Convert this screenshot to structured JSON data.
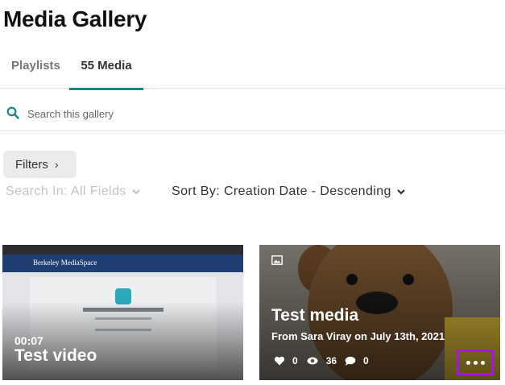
{
  "page": {
    "title": "Media Gallery"
  },
  "tabs": [
    {
      "label": "Playlists",
      "active": false
    },
    {
      "label": "55 Media",
      "active": true
    }
  ],
  "search": {
    "placeholder": "Search this gallery",
    "value": ""
  },
  "filters": {
    "label": "Filters",
    "icon": "chevron-right-icon"
  },
  "search_in": {
    "label": "Search In: All Fields",
    "icon": "chevron-down-icon",
    "disabled": true
  },
  "sort": {
    "label": "Sort By: Creation Date - Descending",
    "icon": "chevron-down-icon"
  },
  "media": [
    {
      "type": "video",
      "name": "Test video",
      "duration": "00:07",
      "thumbnail_text": "Berkeley MediaSpace"
    },
    {
      "type": "image",
      "type_icon": "image-icon",
      "name": "Test media",
      "subtitle": "From Sara Viray on July 13th, 2021",
      "likes": "0",
      "views": "36",
      "comments": "0",
      "more_icon": "ellipsis-icon"
    }
  ],
  "colors": {
    "accent": "#138a8a",
    "highlight": "#a516e6"
  }
}
